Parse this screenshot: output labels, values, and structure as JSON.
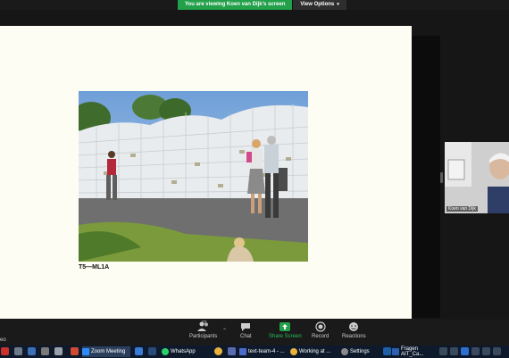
{
  "share_banner": {
    "viewing_text": "You are viewing Koen van Dijk's screen",
    "view_options_label": "View Options"
  },
  "slide": {
    "caption": "T5—ML1A"
  },
  "participant": {
    "name": "Koen van Dijk"
  },
  "toolbar": {
    "left_label": "eo",
    "participants_label": "Participants",
    "participants_count": "23",
    "chat_label": "Chat",
    "share_screen_label": "Share Screen",
    "record_label": "Record",
    "reactions_label": "Reactions"
  },
  "taskbar": {
    "zoom_meeting": "Zoom Meeting",
    "whatsapp": "WhatsApp",
    "text_team": "text-team-4 - ...",
    "working_at": "Working at ...",
    "settings": "Settings",
    "fragen": "Fragen AIT_Ca..."
  },
  "colors": {
    "share_green": "#23a04a",
    "slide_bg": "#fdfdf4",
    "taskbar_bg": "#0e1a2c"
  }
}
